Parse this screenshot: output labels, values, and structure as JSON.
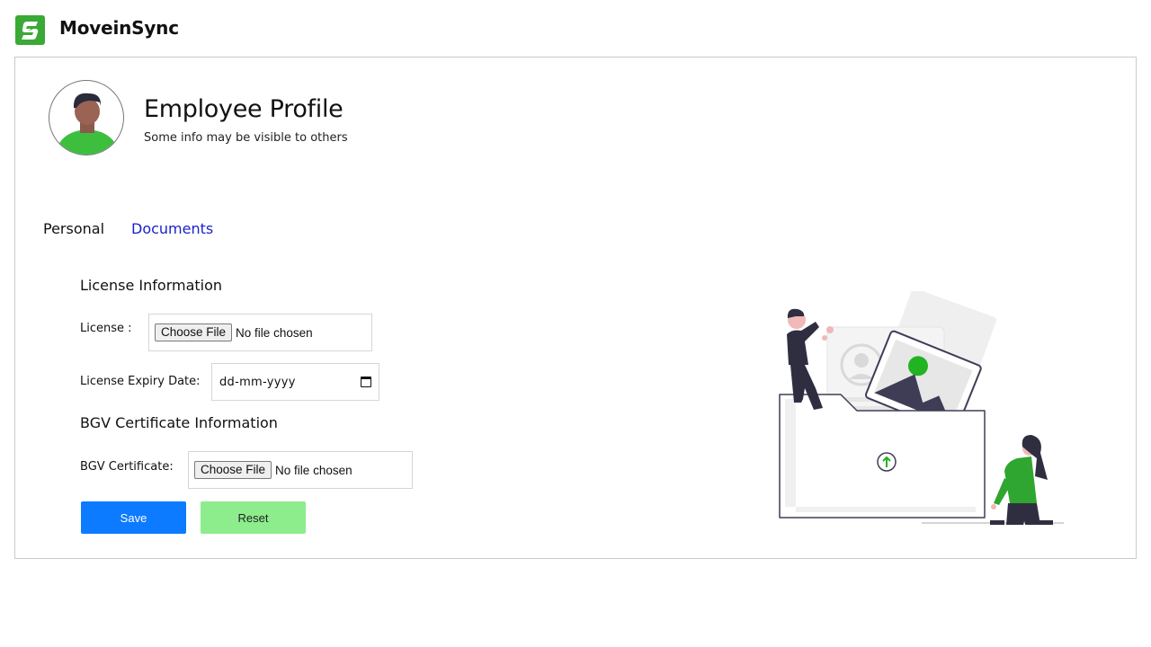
{
  "header": {
    "brand_name": "MoveinSync",
    "logo_icon": "moveinsync-logo-icon",
    "brand_color": "#3aa935"
  },
  "profile": {
    "title": "Employee Profile",
    "subtitle": "Some info may be visible to others"
  },
  "tabs": [
    {
      "label": "Personal",
      "active": false
    },
    {
      "label": "Documents",
      "active": true,
      "color": "#1a22c8"
    }
  ],
  "license_section": {
    "title": "License Information",
    "license_label": "License :",
    "license_button": "Choose File",
    "license_status": "No file chosen",
    "expiry_label": "License Expiry Date:",
    "expiry_placeholder": "dd-mm-yyyy"
  },
  "bgv_section": {
    "title": "BGV Certificate Information",
    "bgv_label": "BGV Certificate:",
    "bgv_button": "Choose File",
    "bgv_status": "No file chosen"
  },
  "actions": {
    "save_label": "Save",
    "reset_label": "Reset",
    "save_color": "#0d7bff",
    "reset_color": "#8ded8d"
  }
}
